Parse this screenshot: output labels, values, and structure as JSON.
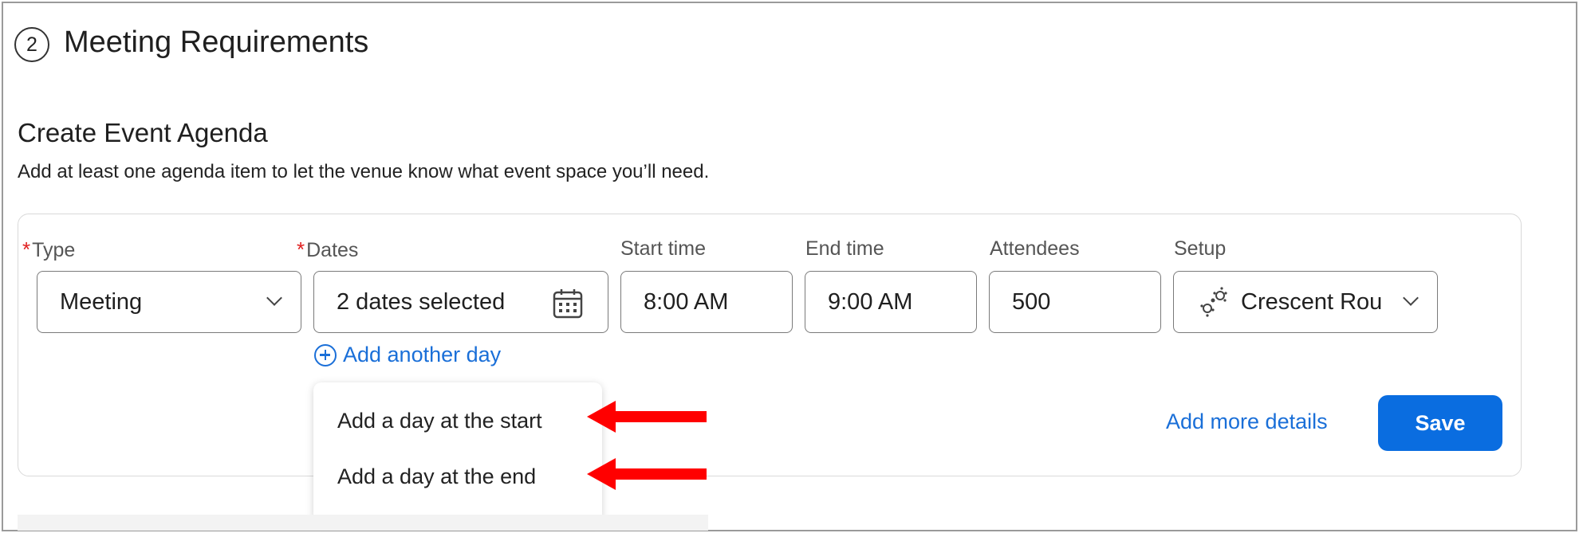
{
  "section": {
    "step_number": "2",
    "title": "Meeting Requirements"
  },
  "agenda": {
    "title": "Create Event Agenda",
    "description": "Add at least one agenda item to let the venue know what event space you’ll need."
  },
  "fields": {
    "type": {
      "label": "Type",
      "required_mark": "*",
      "value": "Meeting"
    },
    "dates": {
      "label": "Dates",
      "required_mark": "*",
      "value": "2 dates selected"
    },
    "start_time": {
      "label": "Start time",
      "value": "8:00 AM"
    },
    "end_time": {
      "label": "End time",
      "value": "9:00 AM"
    },
    "attendees": {
      "label": "Attendees",
      "value": "500"
    },
    "setup": {
      "label": "Setup",
      "value": "Crescent Rou"
    }
  },
  "add_another_day": "Add another day",
  "dropdown": {
    "items": [
      {
        "label": "Add a day at the start"
      },
      {
        "label": "Add a day at the end"
      }
    ]
  },
  "actions": {
    "more_details": "Add more details",
    "save": "Save"
  },
  "colors": {
    "accent": "#0a6de0",
    "link": "#1a6fd8",
    "required": "#e02020",
    "annotation_arrow": "#ff0000"
  }
}
